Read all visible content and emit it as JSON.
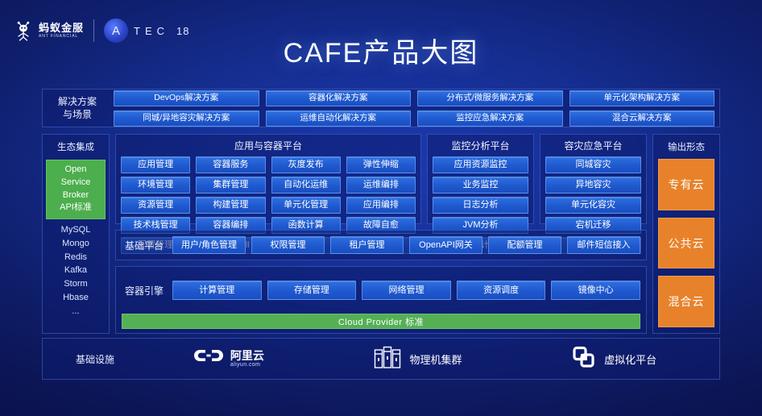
{
  "header": {
    "brand_cn": "蚂蚁金服",
    "brand_en": "ANT FINANCIAL",
    "event_letters": "TEC",
    "event_badge": "A",
    "event_year": "18",
    "title": "CAFE产品大图"
  },
  "solutions": {
    "label": "解决方案\n与场景",
    "label_line1": "解决方案",
    "label_line2": "与场景",
    "row1": [
      "DevOps解决方案",
      "容器化解决方案",
      "分布式/微服务解决方案",
      "单元化架构解决方案"
    ],
    "row2": [
      "同城/异地容灾解决方案",
      "运维自动化解决方案",
      "监控应急解决方案",
      "混合云解决方案"
    ]
  },
  "ecosystem": {
    "title": "生态集成",
    "standard": [
      "Open",
      "Service",
      "Broker",
      "API标准"
    ],
    "items": [
      "MySQL",
      "Mongo",
      "Redis",
      "Kafka",
      "Storm",
      "Hbase",
      "..."
    ]
  },
  "app_platform": {
    "title": "应用与容器平台",
    "columns": [
      [
        "应用管理",
        "环境管理",
        "资源管理",
        "技术栈管理",
        "配置管理"
      ],
      [
        "容器服务",
        "集群管理",
        "构建管理",
        "容器编排",
        "WebShell"
      ],
      [
        "灰度发布",
        "自动化运维",
        "单元化管理",
        "函数计算",
        "ChatOps"
      ],
      [
        "弹性伸缩",
        "运维编排",
        "应用编排",
        "故障自愈",
        "混合云管理"
      ]
    ]
  },
  "monitor_platform": {
    "title": "监控分析平台",
    "items": [
      "应用资源监控",
      "业务监控",
      "日志分析",
      "JVM分析",
      "事件审计分析"
    ]
  },
  "disaster_platform": {
    "title": "容灾应急平台",
    "items": [
      "同城容灾",
      "异地容灾",
      "单元化容灾",
      "宕机迁移",
      "应急运维"
    ]
  },
  "base_platform": {
    "label": "基础平台",
    "items": [
      "用户/角色管理",
      "权限管理",
      "租户管理",
      "OpenAPI网关",
      "配额管理",
      "邮件短信接入"
    ]
  },
  "container_engine": {
    "label": "容器引擎",
    "items": [
      "计算管理",
      "存储管理",
      "网络管理",
      "资源调度",
      "镜像中心"
    ],
    "cloud_provider_bar": "Cloud Provider 标准"
  },
  "output": {
    "title": "输出形态",
    "items": [
      "专有云",
      "公共云",
      "混合云"
    ]
  },
  "infrastructure": {
    "label": "基础设施",
    "items": [
      {
        "name_cn": "阿里云",
        "name_en": "aliyun.com",
        "icon": "aliyun-logo-icon"
      },
      {
        "name_cn": "物理机集群",
        "name_en": "",
        "icon": "server-rack-icon"
      },
      {
        "name_cn": "虚拟化平台",
        "name_en": "",
        "icon": "virtualization-icon"
      }
    ]
  },
  "colors": {
    "background_deep": "#0a1148",
    "background_mid": "#17309e",
    "chip_blue": "#2f6fe0",
    "green": "#4cae4c",
    "orange": "#e8822a",
    "panel_border": "#608cff"
  }
}
